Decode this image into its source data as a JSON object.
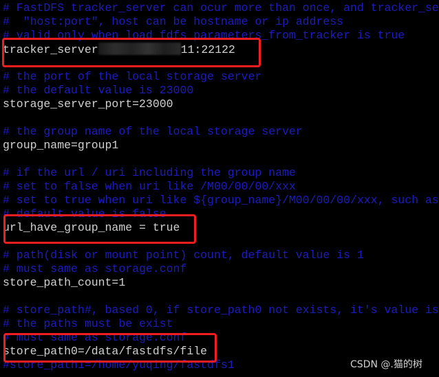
{
  "lines": [
    {
      "type": "comment",
      "text": "# FastDFS tracker_server can ocur more than once, and tracker_se"
    },
    {
      "type": "comment",
      "text": "#  \"host:port\", host can be hostname or ip address"
    },
    {
      "type": "comment",
      "text": "# valid only when load_fdfs_parameters_from_tracker is true"
    },
    {
      "type": "cfg",
      "text": "tracker_server",
      "redacted": true,
      "suffix": "11:22122"
    },
    {
      "type": "blank",
      "text": ""
    },
    {
      "type": "comment",
      "text": "# the port of the local storage server"
    },
    {
      "type": "comment",
      "text": "# the default value is 23000"
    },
    {
      "type": "cfg",
      "text": "storage_server_port=23000"
    },
    {
      "type": "blank",
      "text": ""
    },
    {
      "type": "comment",
      "text": "# the group name of the local storage server"
    },
    {
      "type": "cfg",
      "text": "group_name=group1"
    },
    {
      "type": "blank",
      "text": ""
    },
    {
      "type": "comment",
      "text": "# if the url / uri including the group name"
    },
    {
      "type": "comment",
      "text": "# set to false when uri like /M00/00/00/xxx"
    },
    {
      "type": "comment",
      "text": "# set to true when uri like ${group_name}/M00/00/00/xxx, such as"
    },
    {
      "type": "comment",
      "text": "# default value is false"
    },
    {
      "type": "cfg",
      "text": "url_have_group_name = true"
    },
    {
      "type": "blank",
      "text": ""
    },
    {
      "type": "comment",
      "text": "# path(disk or mount point) count, default value is 1"
    },
    {
      "type": "comment",
      "text": "# must same as storage.conf"
    },
    {
      "type": "cfg",
      "text": "store_path_count=1"
    },
    {
      "type": "blank",
      "text": ""
    },
    {
      "type": "comment",
      "text": "# store_path#, based 0, if store_path0 not exists, it's value is"
    },
    {
      "type": "comment",
      "text": "# the paths must be exist"
    },
    {
      "type": "comment",
      "text": "# must same as storage.conf"
    },
    {
      "type": "cfg",
      "text": "store_path0=/data/fastdfs/file"
    },
    {
      "type": "comment",
      "text": "#store_path1=/home/yuqing/fastdfs1"
    }
  ],
  "watermark": "CSDN @.猫的树",
  "colors": {
    "comment": "#1c1cc0",
    "text": "#d0d0d0",
    "highlight": "#f01e1e",
    "background": "#000000"
  }
}
